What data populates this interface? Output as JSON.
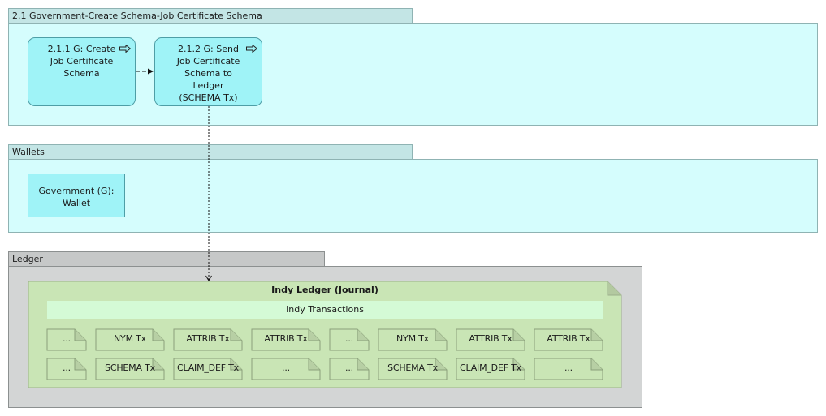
{
  "groups": {
    "schema_group": {
      "title": "2.1 Government-Create Schema-Job Certificate Schema"
    },
    "wallets_group": {
      "title": "Wallets"
    },
    "ledger_group": {
      "title": "Ledger"
    }
  },
  "processes": [
    {
      "label": "2.1.1 G: Create Job Certificate Schema"
    },
    {
      "label": "2.1.2 G: Send Job Certificate Schema to Ledger (SCHEMA Tx)"
    }
  ],
  "wallet": {
    "label": "Government (G): Wallet"
  },
  "journal": {
    "title": "Indy Ledger (Journal)",
    "transactions_label": "Indy Transactions",
    "rows": [
      [
        "...",
        "NYM Tx",
        "ATTRIB Tx",
        "ATTRIB Tx",
        "...",
        "NYM Tx",
        "ATTRIB Tx",
        "ATTRIB Tx"
      ],
      [
        "...",
        "SCHEMA Tx",
        "CLAIM_DEF Tx",
        "...",
        "...",
        "SCHEMA Tx",
        "CLAIM_DEF Tx",
        "..."
      ]
    ]
  },
  "colors": {
    "process_fill": "#9ff3f7",
    "swimlane_fill": "#d5fdfd",
    "ledger_fill": "#d3d5d5",
    "journal_fill": "#c9e5b5",
    "tx_doc_fill": "#c9e5b5"
  },
  "icons": {
    "process": "arrow-right-outline-icon"
  }
}
